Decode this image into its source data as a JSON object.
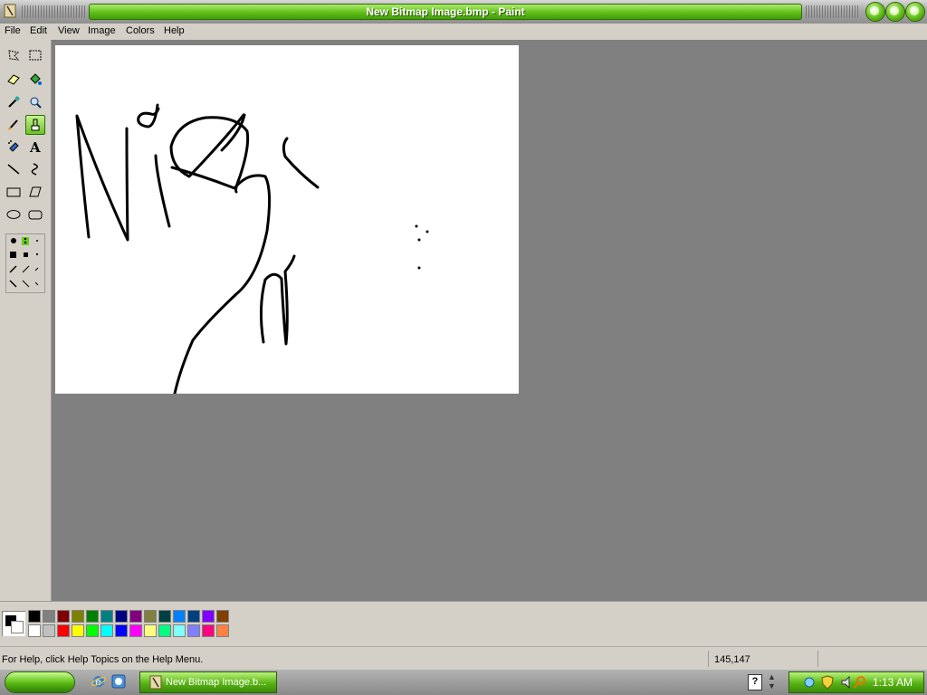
{
  "window": {
    "title": "New Bitmap Image.bmp - Paint"
  },
  "menu": [
    "File",
    "Edit",
    "View",
    "Image",
    "Colors",
    "Help"
  ],
  "tools": [
    {
      "name": "free-form-select-tool-icon"
    },
    {
      "name": "select-tool-icon"
    },
    {
      "name": "eraser-tool-icon"
    },
    {
      "name": "fill-tool-icon"
    },
    {
      "name": "pick-color-tool-icon"
    },
    {
      "name": "magnifier-tool-icon"
    },
    {
      "name": "pencil-tool-icon"
    },
    {
      "name": "brush-tool-icon",
      "active": true
    },
    {
      "name": "airbrush-tool-icon"
    },
    {
      "name": "text-tool-icon"
    },
    {
      "name": "line-tool-icon"
    },
    {
      "name": "curve-tool-icon"
    },
    {
      "name": "rectangle-tool-icon"
    },
    {
      "name": "polygon-tool-icon"
    },
    {
      "name": "ellipse-tool-icon"
    },
    {
      "name": "rounded-rectangle-tool-icon"
    }
  ],
  "palette": {
    "foreground": "#000000",
    "background": "#ffffff",
    "colors": [
      "#000000",
      "#808080",
      "#800000",
      "#808000",
      "#008000",
      "#008080",
      "#000080",
      "#800080",
      "#808040",
      "#004040",
      "#0080ff",
      "#004080",
      "#8000ff",
      "#804000",
      "#ffffff",
      "#c0c0c0",
      "#ff0000",
      "#ffff00",
      "#00ff00",
      "#00ffff",
      "#0000ff",
      "#ff00ff",
      "#ffff80",
      "#00ff80",
      "#80ffff",
      "#8080ff",
      "#ff0080",
      "#ff8040"
    ]
  },
  "status": {
    "help_text": "For Help, click Help Topics on the Help Menu.",
    "coordinates": "145,147"
  },
  "taskbar": {
    "task_label": "New Bitmap Image.b...",
    "clock": "1:13 AM",
    "help_glyph": "?"
  },
  "colors": {
    "accent_green": "#5fbf16",
    "window_face": "#d4d0c8",
    "workspace": "#808080"
  }
}
